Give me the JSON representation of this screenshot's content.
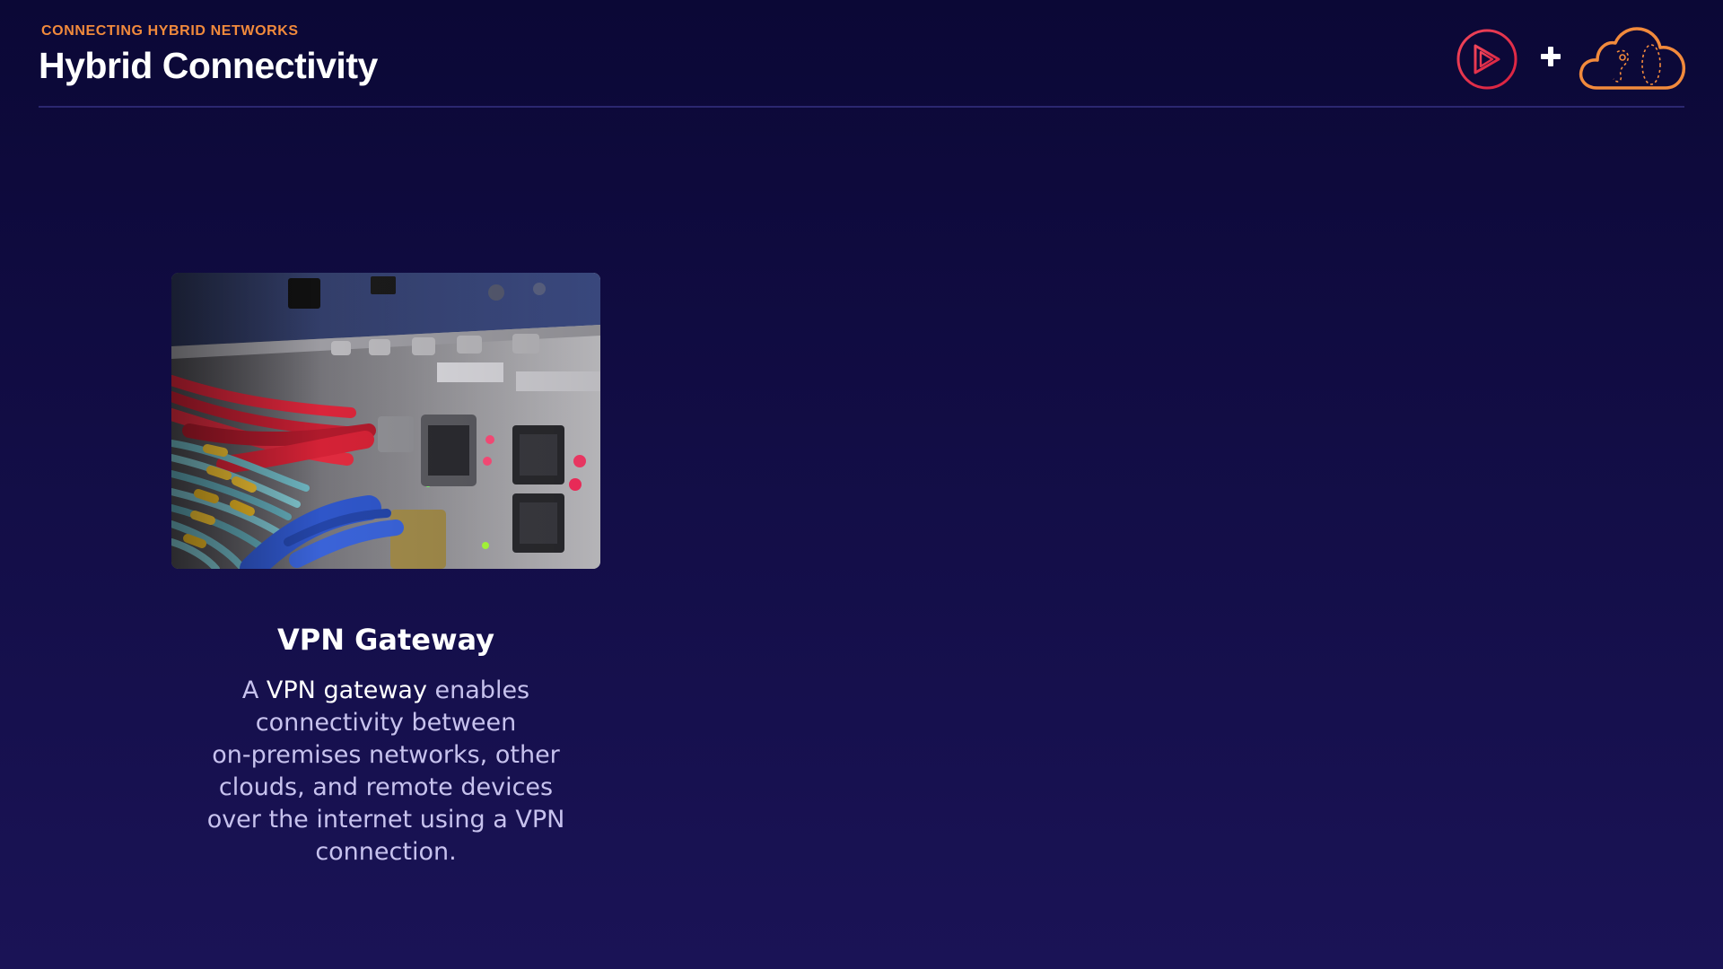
{
  "header": {
    "eyebrow": "CONNECTING HYBRID NETWORKS",
    "title": "Hybrid Connectivity",
    "plus_symbol": "+"
  },
  "logos": {
    "left": "play-circle-logo",
    "right": "cloud-logo",
    "play_color": "#e8334a",
    "cloud_color": "#f28a3c"
  },
  "card": {
    "image": "network-switch-fiber-cables-photo",
    "title": "VPN Gateway",
    "body": {
      "prefix": "A ",
      "highlight": "VPN gateway",
      "line1_rest": " enables",
      "line2": "connectivity between",
      "line3": "on-premises networks, other",
      "line4": "clouds, and remote devices",
      "line5": "over the internet using a VPN",
      "line6": "connection."
    }
  },
  "colors": {
    "background_top": "#0b0836",
    "background_bottom": "#1a1356",
    "accent": "#f28a3c",
    "body_text": "#c7c2ee"
  }
}
